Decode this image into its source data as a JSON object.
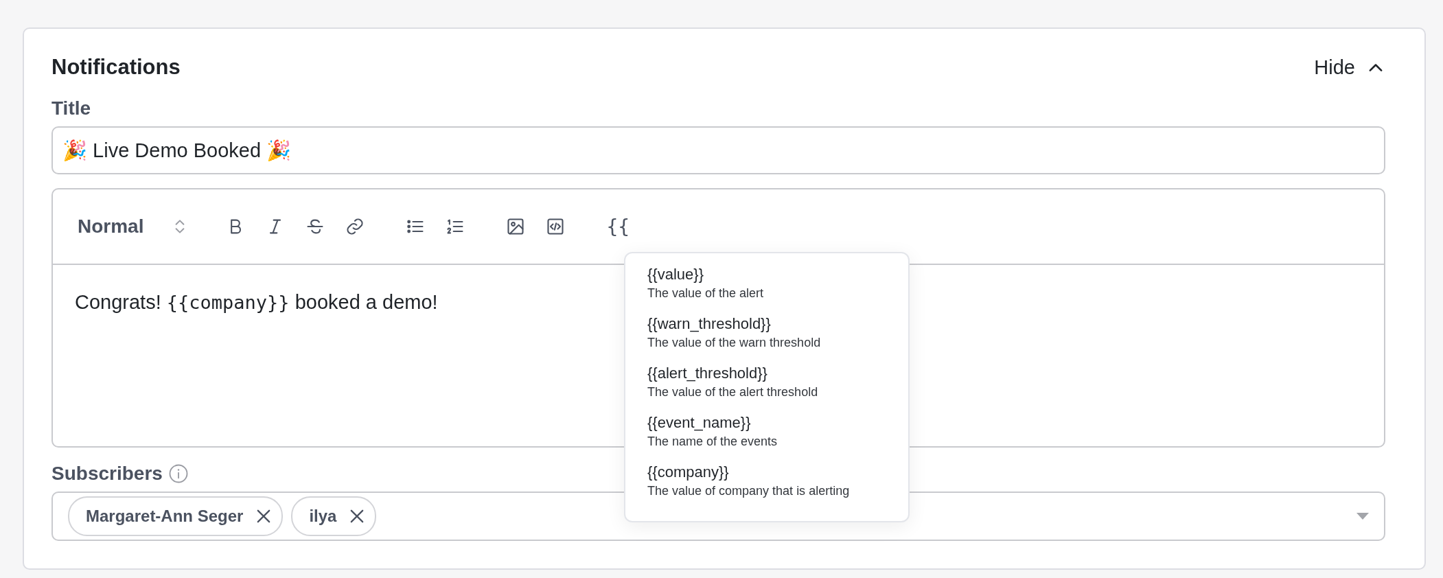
{
  "section": {
    "title": "Notifications",
    "toggle": {
      "label": "Hide",
      "expanded": true
    }
  },
  "title_field": {
    "label": "Title",
    "value": "🎉 Live Demo Booked 🎉"
  },
  "editor": {
    "format": "Normal",
    "toolbar": [
      {
        "kind": "bold"
      },
      {
        "kind": "italic"
      },
      {
        "kind": "strike"
      },
      {
        "kind": "link"
      },
      {
        "kind": "bullets"
      },
      {
        "kind": "numbers"
      },
      {
        "kind": "image"
      },
      {
        "kind": "code"
      },
      {
        "kind": "variable",
        "label": "{{"
      }
    ],
    "body": [
      {
        "kind": "plain",
        "text": "Congrats! "
      },
      {
        "kind": "code",
        "text": "{{company}}"
      },
      {
        "kind": "plain",
        "text": " booked a demo!"
      }
    ]
  },
  "variables_menu": [
    {
      "name": "{{value}}",
      "description": "The value of the alert"
    },
    {
      "name": "{{warn_threshold}}",
      "description": "The value of the warn threshold"
    },
    {
      "name": "{{alert_threshold}}",
      "description": "The value of the alert threshold"
    },
    {
      "name": "{{event_name}}",
      "description": "The name of the events"
    },
    {
      "name": "{{company}}",
      "description": "The value of company that is alerting"
    }
  ],
  "subscribers": {
    "label": "Subscribers",
    "chips": [
      "Margaret-Ann Seger",
      "ilya"
    ]
  }
}
